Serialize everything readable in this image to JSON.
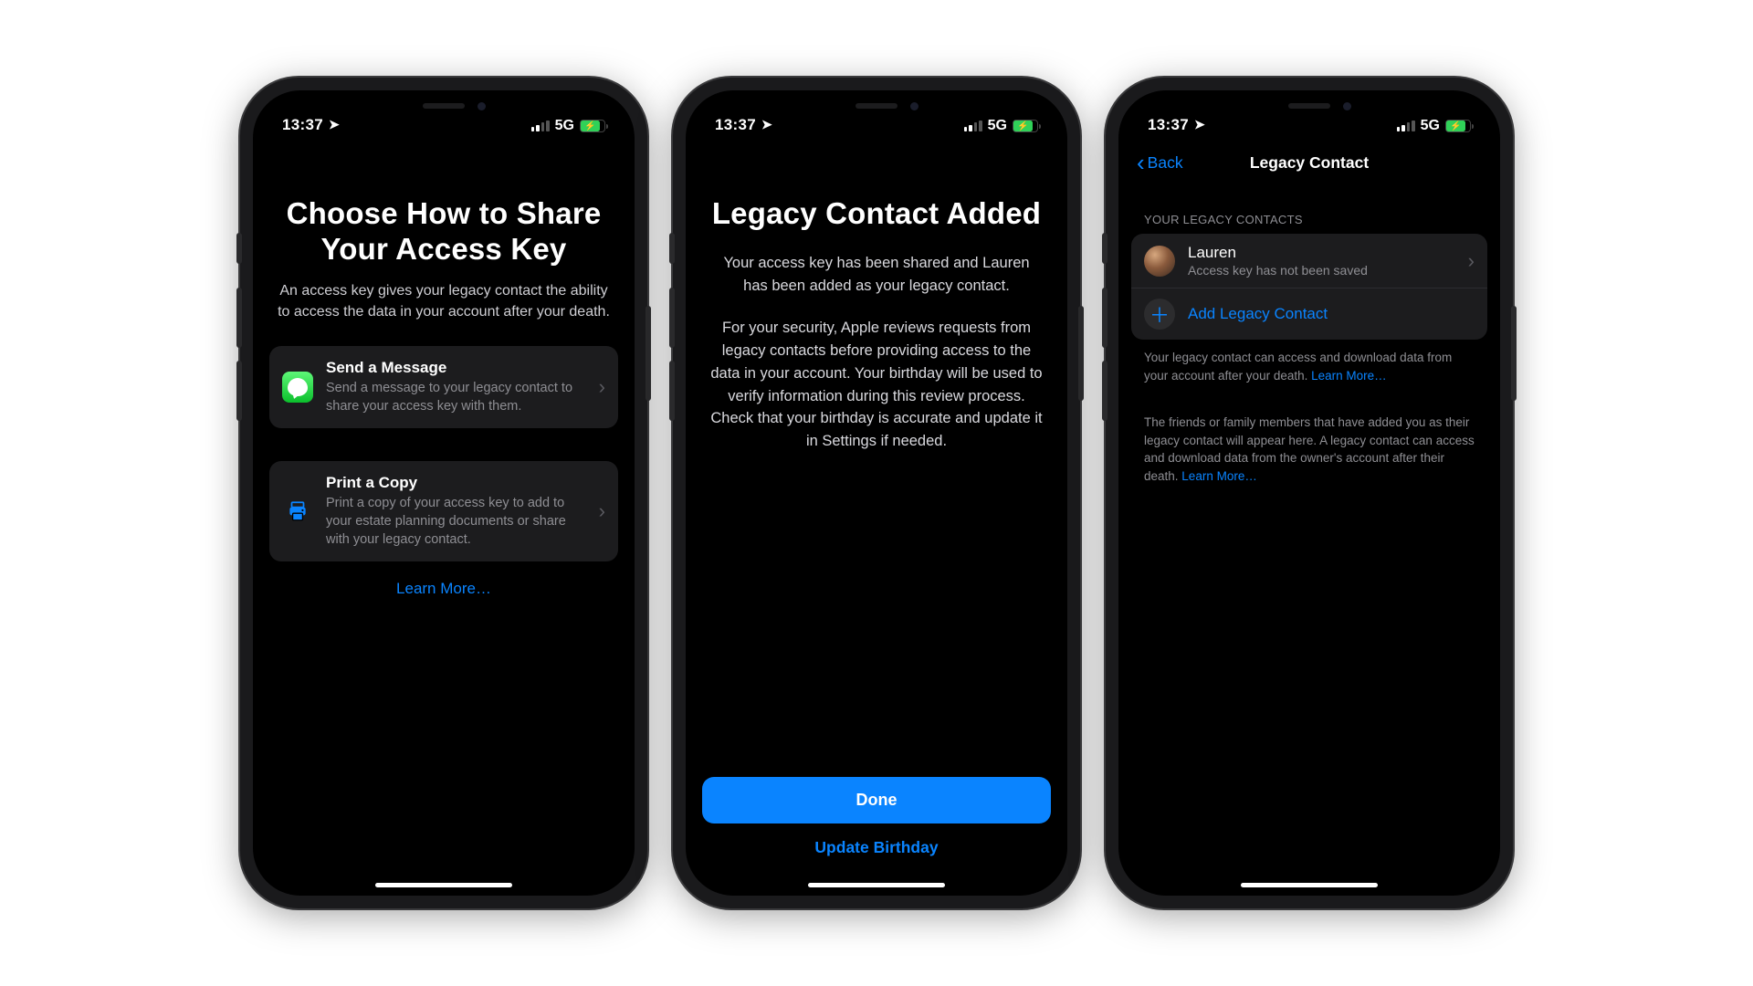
{
  "status": {
    "time": "13:37",
    "network": "5G"
  },
  "screen1": {
    "title": "Choose How to Share Your Access Key",
    "subtitle": "An access key gives your legacy contact the ability to access the data in your account after your death.",
    "send": {
      "title": "Send a Message",
      "desc": "Send a message to your legacy contact to share your access key with them."
    },
    "print": {
      "title": "Print a Copy",
      "desc": "Print a copy of your access key to add to your estate planning documents or share with your legacy contact."
    },
    "learn_more": "Learn More…"
  },
  "screen2": {
    "title": "Legacy Contact Added",
    "p1": "Your access key has been shared and Lauren                    has been added as your legacy contact.",
    "p2": "For your security, Apple reviews requests from legacy contacts before providing access to the data in your account. Your birthday will be used to verify information during this review process. Check that your birthday is accurate and update it in Settings if needed.",
    "done": "Done",
    "update": "Update Birthday"
  },
  "screen3": {
    "back": "Back",
    "title": "Legacy Contact",
    "section_header": "YOUR LEGACY CONTACTS",
    "contact": {
      "name": "Lauren",
      "sub": "Access key has not been saved"
    },
    "add": "Add Legacy Contact",
    "footer1": "Your legacy contact can access and download data from your account after your death. ",
    "footer2": "The friends or family members that have added you as their legacy contact will appear here. A legacy contact can access and download data from the owner's account after their death. ",
    "learn_more": "Learn More…"
  }
}
